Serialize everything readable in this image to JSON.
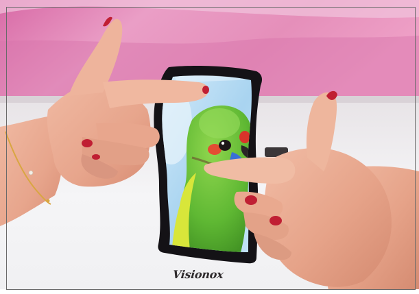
{
  "photo": {
    "brand_logo": "Visionox",
    "colors": {
      "backdrop": "#e58fba",
      "table": "#f3f3f5",
      "phone_bezel": "#141216",
      "bird_body": "#6fc23c",
      "nail_polish": "#c01f33",
      "skin": "#e9ab93"
    }
  }
}
